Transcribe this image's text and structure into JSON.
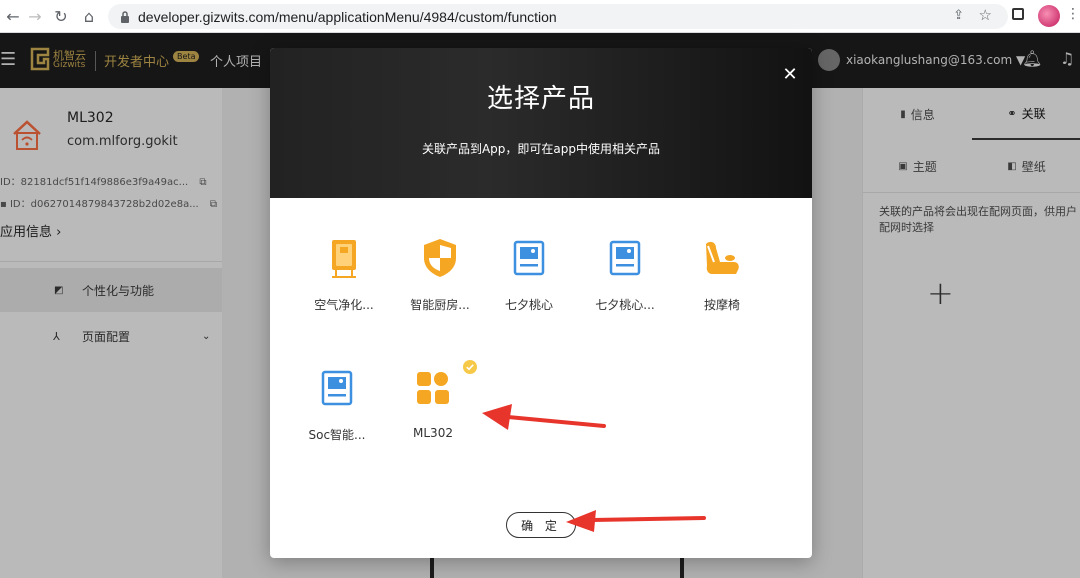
{
  "browser": {
    "url": "developer.gizwits.com/menu/applicationMenu/4984/custom/function"
  },
  "header": {
    "logo_text": "机智云",
    "logo_sub": "Gizwits",
    "dev_center": "开发者中心",
    "beta_badge": "Beta",
    "personal_project": "个人项目",
    "account": "xiaokanglushang@163.com ▼"
  },
  "sidebar": {
    "app_name": "ML302",
    "app_package": "com.mlforg.gokit",
    "ios_id_label": "ID：",
    "ios_id_value": "82181dcf51f14f9886e3f9a49ac...",
    "android_id_label": "ID：",
    "android_id_value": "d0627014879843728b2d02e8a...",
    "app_info": "应用信息",
    "menu": [
      {
        "label": "个性化与功能"
      },
      {
        "label": "页面配置"
      }
    ]
  },
  "right_panel": {
    "tabs": [
      {
        "label": "信息"
      },
      {
        "label": "关联"
      },
      {
        "label": "主题"
      },
      {
        "label": "壁纸"
      }
    ],
    "description": "关联的产品将会出现在配网页面，供用户配网时选择"
  },
  "modal": {
    "title": "选择产品",
    "subtitle": "关联产品到App，即可在app中使用相关产品",
    "confirm_label": "确 定",
    "products": [
      {
        "label": "空气净化...",
        "icon": "air-purifier-icon"
      },
      {
        "label": "智能厨房...",
        "icon": "shield-icon"
      },
      {
        "label": "七夕桃心",
        "icon": "device-box-icon"
      },
      {
        "label": "七夕桃心...",
        "icon": "device-box-icon"
      },
      {
        "label": "按摩椅",
        "icon": "massage-chair-icon"
      },
      {
        "label": "Soc智能...",
        "icon": "device-box-icon"
      },
      {
        "label": "ML302",
        "icon": "grid-apps-icon",
        "selected": true
      }
    ]
  },
  "colors": {
    "accent_orange": "#f5a623",
    "accent_blue": "#3d8fe0",
    "arrow_red": "#e8352c"
  }
}
